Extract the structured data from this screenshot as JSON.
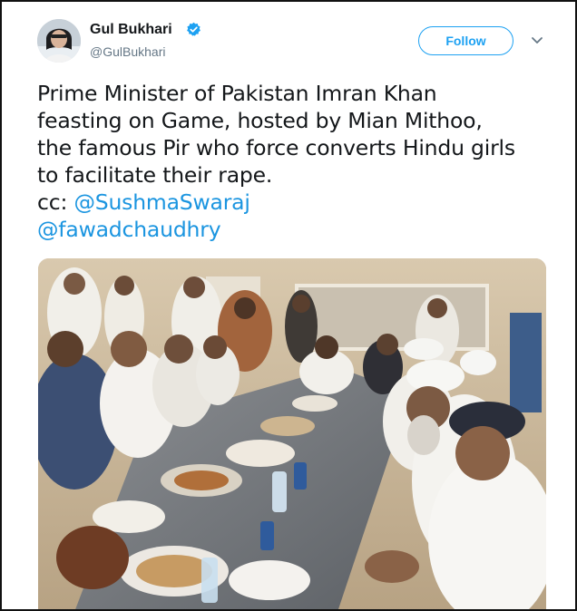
{
  "tweet": {
    "author_name": "Gul Bukhari",
    "author_handle": "@GulBukhari",
    "verified_icon": "verified-badge-icon",
    "follow_label": "Follow",
    "menu_icon": "chevron-down-icon",
    "text_lines": [
      "Prime Minister of Pakistan Imran Khan",
      "feasting on Game, hosted by Mian Mithoo,",
      "the famous Pir who force converts Hindu girls",
      "to facilitate their rape."
    ],
    "cc_prefix": "cc: ",
    "mentions": [
      "@SushmaSwaraj",
      "@fawadchaudhry"
    ],
    "accent_color": "#1da1f2"
  }
}
